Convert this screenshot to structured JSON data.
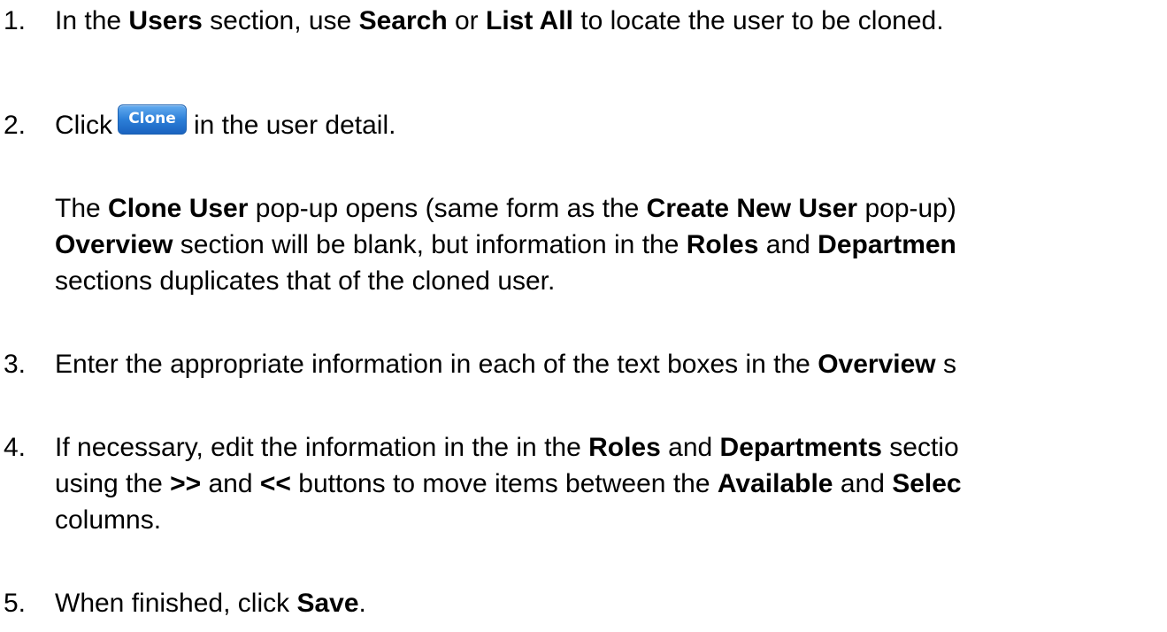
{
  "steps": [
    {
      "number": "1.",
      "text": [
        "In the ",
        "Users",
        " section, use ",
        "Search",
        " or ",
        "List All",
        " to locate the user to be cloned."
      ]
    },
    {
      "number": "2.",
      "text_before": "Click",
      "button_label": "Clone",
      "text_after": "in the user detail.",
      "note_line1": [
        "The ",
        "Clone User",
        " pop-up opens (same form as the ",
        "Create New User",
        " pop-up)"
      ],
      "note_line2": [
        "Overview",
        " section will be blank, but information in the ",
        "Roles",
        " and ",
        "Departmen"
      ],
      "note_line3": "sections duplicates that of the cloned user."
    },
    {
      "number": "3.",
      "text": [
        "Enter the appropriate information in each of the text boxes in the ",
        "Overview",
        " s"
      ]
    },
    {
      "number": "4.",
      "line1": [
        "If necessary, edit the information in the in the ",
        "Roles",
        " and ",
        "Departments",
        " sectio"
      ],
      "line2": [
        "using the ",
        ">>",
        " and ",
        "<<",
        " buttons to move items between the ",
        "Available",
        " and ",
        "Selec"
      ],
      "line3": "columns."
    },
    {
      "number": "5.",
      "text": [
        "When finished, click ",
        "Save",
        "."
      ]
    }
  ]
}
